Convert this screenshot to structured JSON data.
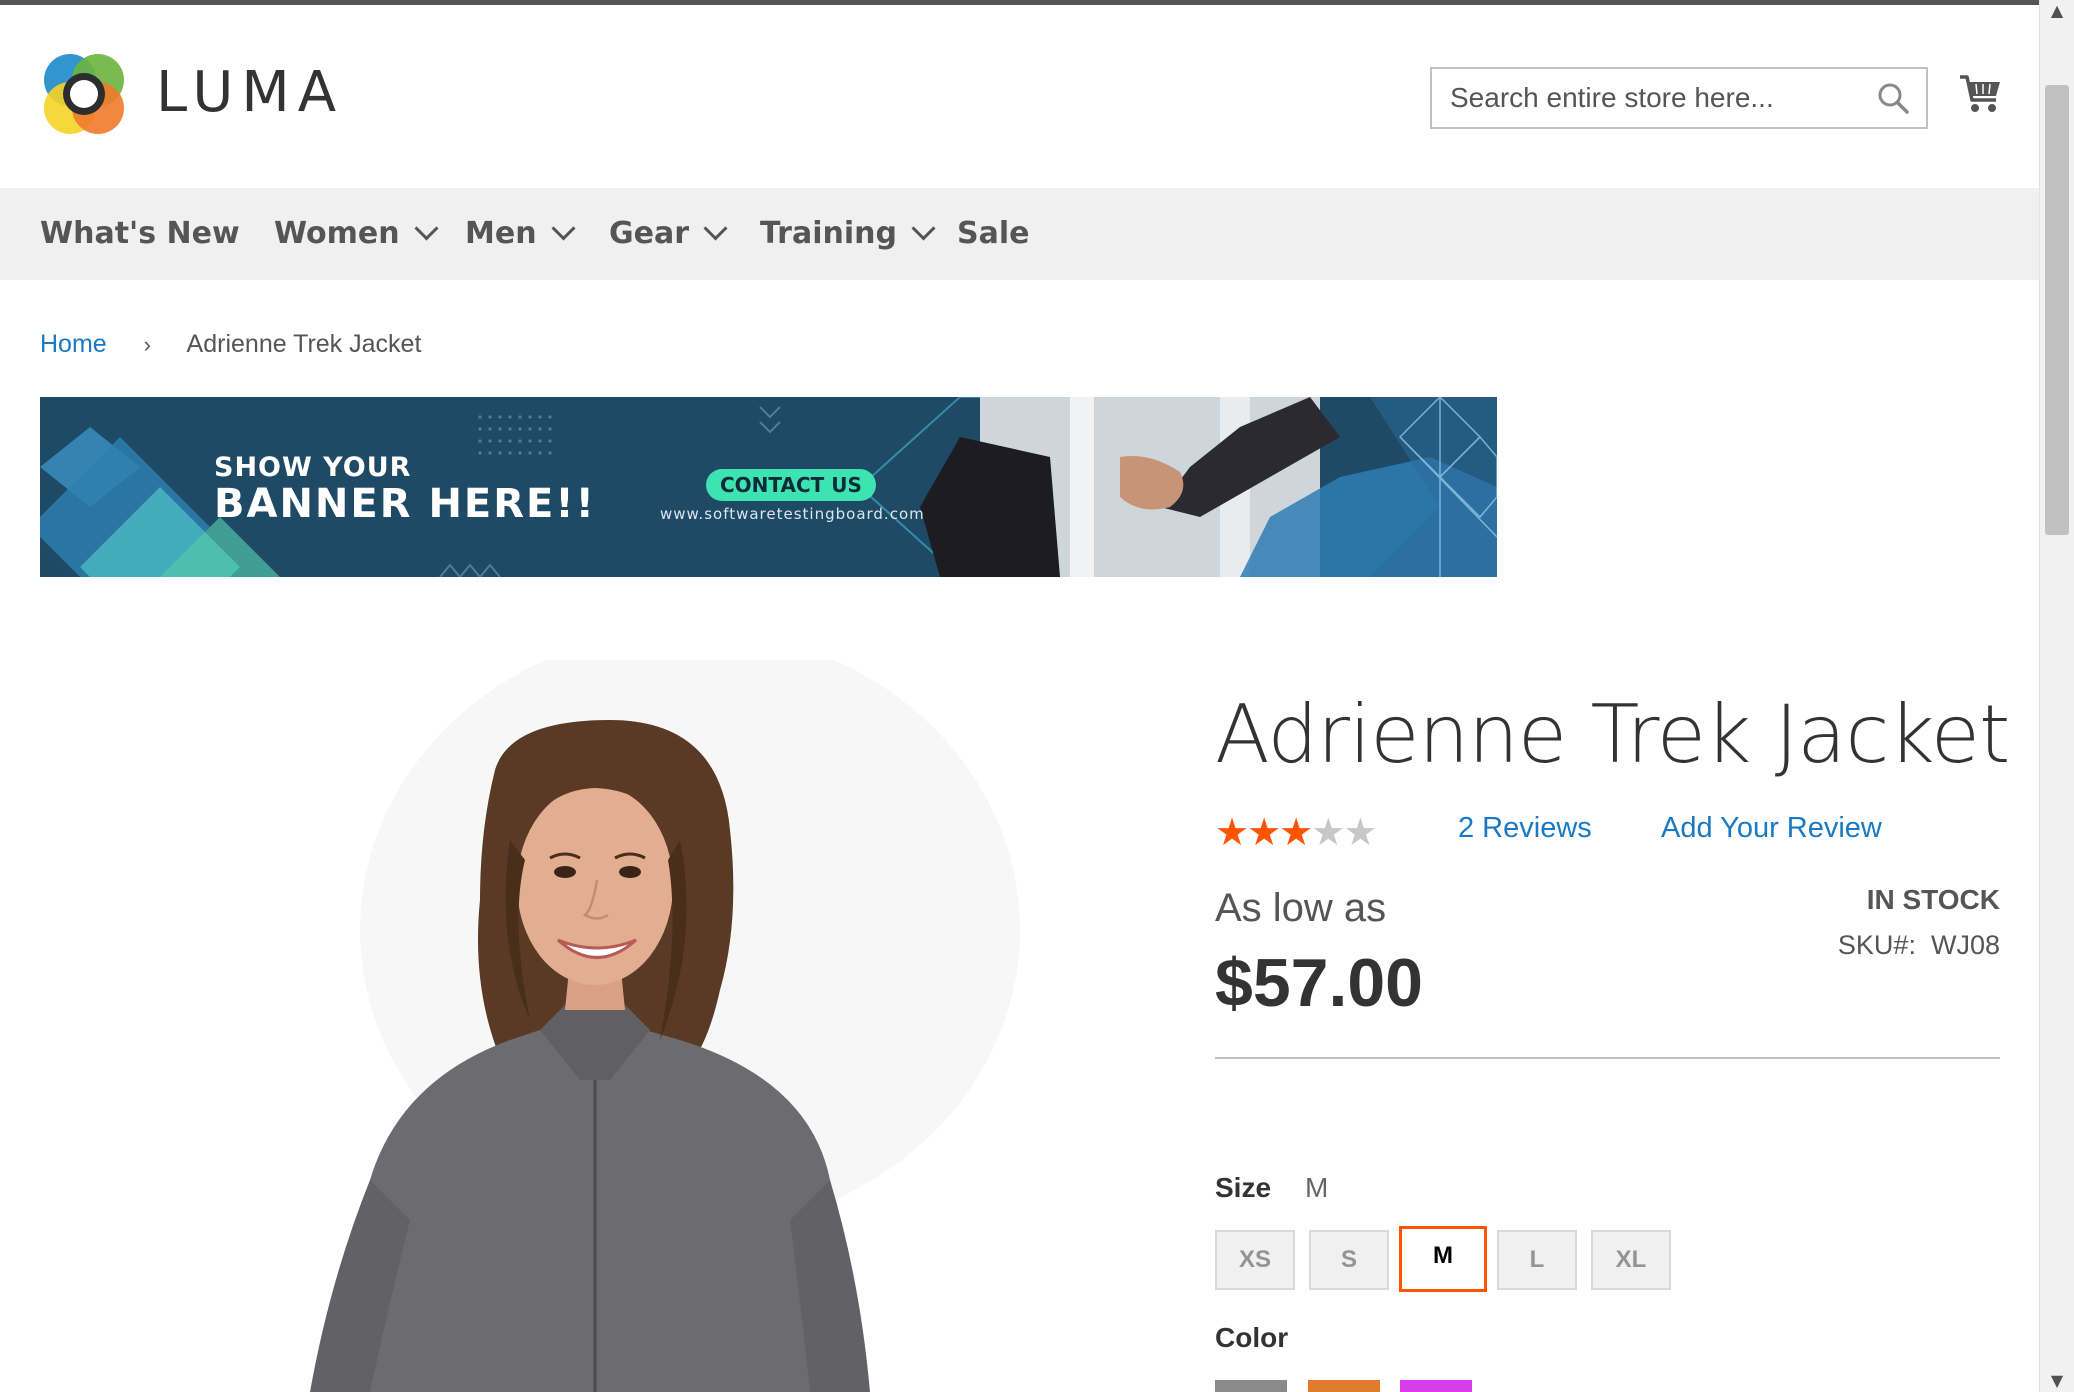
{
  "header": {
    "logo_text": "LUMA",
    "search_placeholder": "Search entire store here..."
  },
  "nav": {
    "items": [
      {
        "label": "What's New",
        "has_dropdown": false
      },
      {
        "label": "Women",
        "has_dropdown": true
      },
      {
        "label": "Men",
        "has_dropdown": true
      },
      {
        "label": "Gear",
        "has_dropdown": true
      },
      {
        "label": "Training",
        "has_dropdown": true
      },
      {
        "label": "Sale",
        "has_dropdown": false
      }
    ]
  },
  "breadcrumb": {
    "home": "Home",
    "separator": "›",
    "current": "Adrienne Trek Jacket"
  },
  "banner": {
    "line1": "SHOW YOUR",
    "line2": "BANNER HERE!!",
    "cta": "CONTACT US",
    "url": "www.softwaretestingboard.com"
  },
  "product": {
    "title": "Adrienne Trek Jacket",
    "rating": 3,
    "rating_max": 5,
    "reviews_label": "2  Reviews",
    "add_review_label": "Add Your Review",
    "price_label": "As low as",
    "price": "$57.00",
    "stock": "In stock",
    "sku_label": "SKU#:",
    "sku": "WJ08",
    "size_label": "Size",
    "size_selected": "M",
    "sizes": [
      "XS",
      "S",
      "M",
      "L",
      "XL"
    ],
    "color_label": "Color",
    "colors": [
      "#8a8a8a",
      "#e07a2f",
      "#d63ce8"
    ]
  },
  "colors": {
    "accent": "#ff5501",
    "link": "#1979c3",
    "nav_bg": "#f0f0f0"
  }
}
